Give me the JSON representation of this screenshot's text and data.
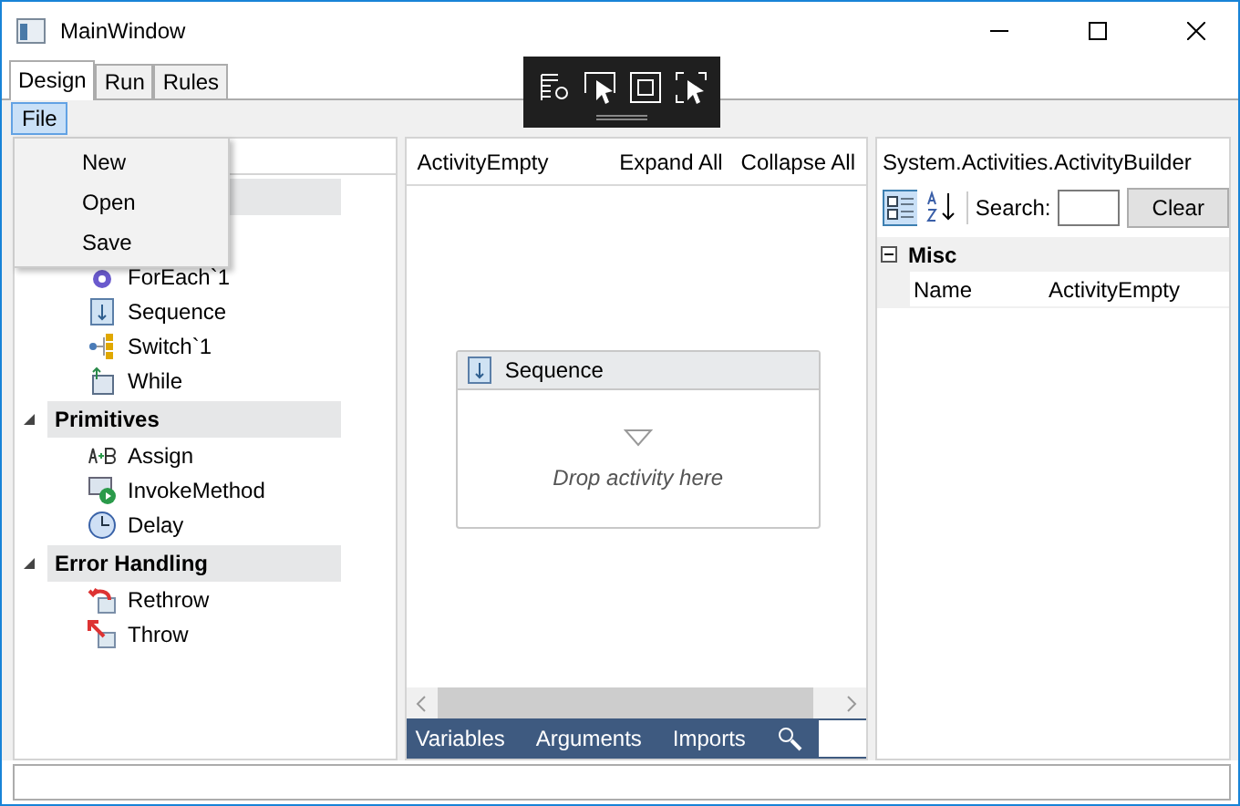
{
  "window": {
    "title": "MainWindow"
  },
  "tabs": [
    {
      "label": "Design",
      "selected": true
    },
    {
      "label": "Run",
      "selected": false
    },
    {
      "label": "Rules",
      "selected": false
    }
  ],
  "menu_bar": [
    {
      "label": "File",
      "selected": true
    }
  ],
  "file_menu": [
    "New",
    "Open",
    "Save"
  ],
  "toolbox": {
    "items": [
      "ForEach`1",
      "Sequence",
      "Switch`1",
      "While"
    ],
    "groups": [
      {
        "label": "Primitives",
        "expanded": true,
        "items": [
          "Assign",
          "InvokeMethod",
          "Delay"
        ]
      },
      {
        "label": "Error Handling",
        "expanded": true,
        "items": [
          "Rethrow",
          "Throw"
        ]
      }
    ]
  },
  "designer": {
    "breadcrumb": "ActivityEmpty",
    "expand_all": "Expand All",
    "collapse_all": "Collapse All",
    "activity": {
      "title": "Sequence",
      "hint": "Drop activity here"
    },
    "bottom_tabs": [
      "Variables",
      "Arguments",
      "Imports"
    ]
  },
  "properties": {
    "type_name": "System.Activities.ActivityBuilder",
    "search_label": "Search:",
    "clear_button": "Clear",
    "categories": [
      {
        "label": "Misc",
        "expanded": true,
        "rows": [
          {
            "name": "Name",
            "value": "ActivityEmpty"
          }
        ]
      }
    ]
  }
}
